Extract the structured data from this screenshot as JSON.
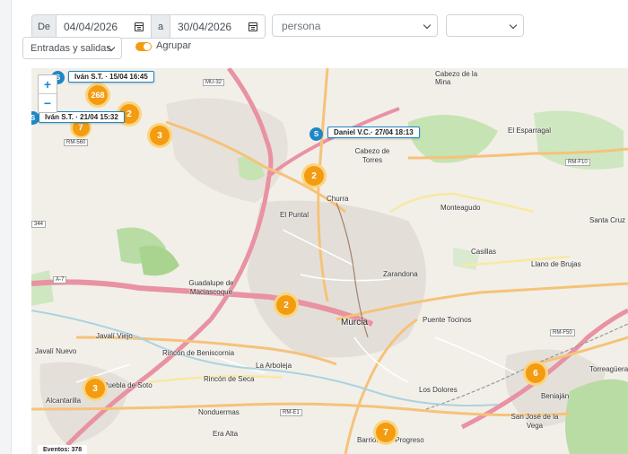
{
  "filters": {
    "from_label": "De",
    "date_from": "04/04/2026",
    "to_label": "a",
    "date_to": "30/04/2026",
    "person_select": "persona",
    "second_select": "",
    "type_select": "Entradas y salidas",
    "group_toggle_label": "Agrupar",
    "group_toggle_on": true,
    "accent_color": "#f39c12"
  },
  "map": {
    "zoom_in": "+",
    "zoom_out": "−",
    "events_label": "Eventos: 378",
    "places": [
      "Cabezo de la Mina",
      "El Esparragal",
      "Cabezo de Torres",
      "Churra",
      "El Puntal",
      "Monteagudo",
      "Santa Cruz",
      "Casillas",
      "Llano de Brujas",
      "Zarandona",
      "Guadalupe de Maciascoque",
      "Murcia",
      "Puente Tocinos",
      "Javalí Viejo",
      "Javalí Nuevo",
      "Rincón de Beniscornia",
      "La Arboleja",
      "Rincón de Seca",
      "Puebla de Soto",
      "Alcantarilla",
      "Nonduermas",
      "Era Alta",
      "Los Dolores",
      "Beniaján",
      "Torreagüera",
      "San José de la Vega",
      "Barriomar - Progreso"
    ],
    "road_labels": [
      "MU-32",
      "RM-560",
      "A-7",
      "RM-F10",
      "RM-F50",
      "RM-E1",
      "344"
    ],
    "clusters": [
      "268",
      "2",
      "3",
      "2",
      "2",
      "3",
      "6",
      "7",
      "7"
    ],
    "markers": [
      {
        "icon": "S",
        "label": "Iván S.T. · 15/04 16:45"
      },
      {
        "icon": "S",
        "label": "Iván S.T. · 21/04 15:32"
      },
      {
        "icon": "S",
        "label": "Daniel V.C.· 27/04 18:13"
      }
    ]
  }
}
